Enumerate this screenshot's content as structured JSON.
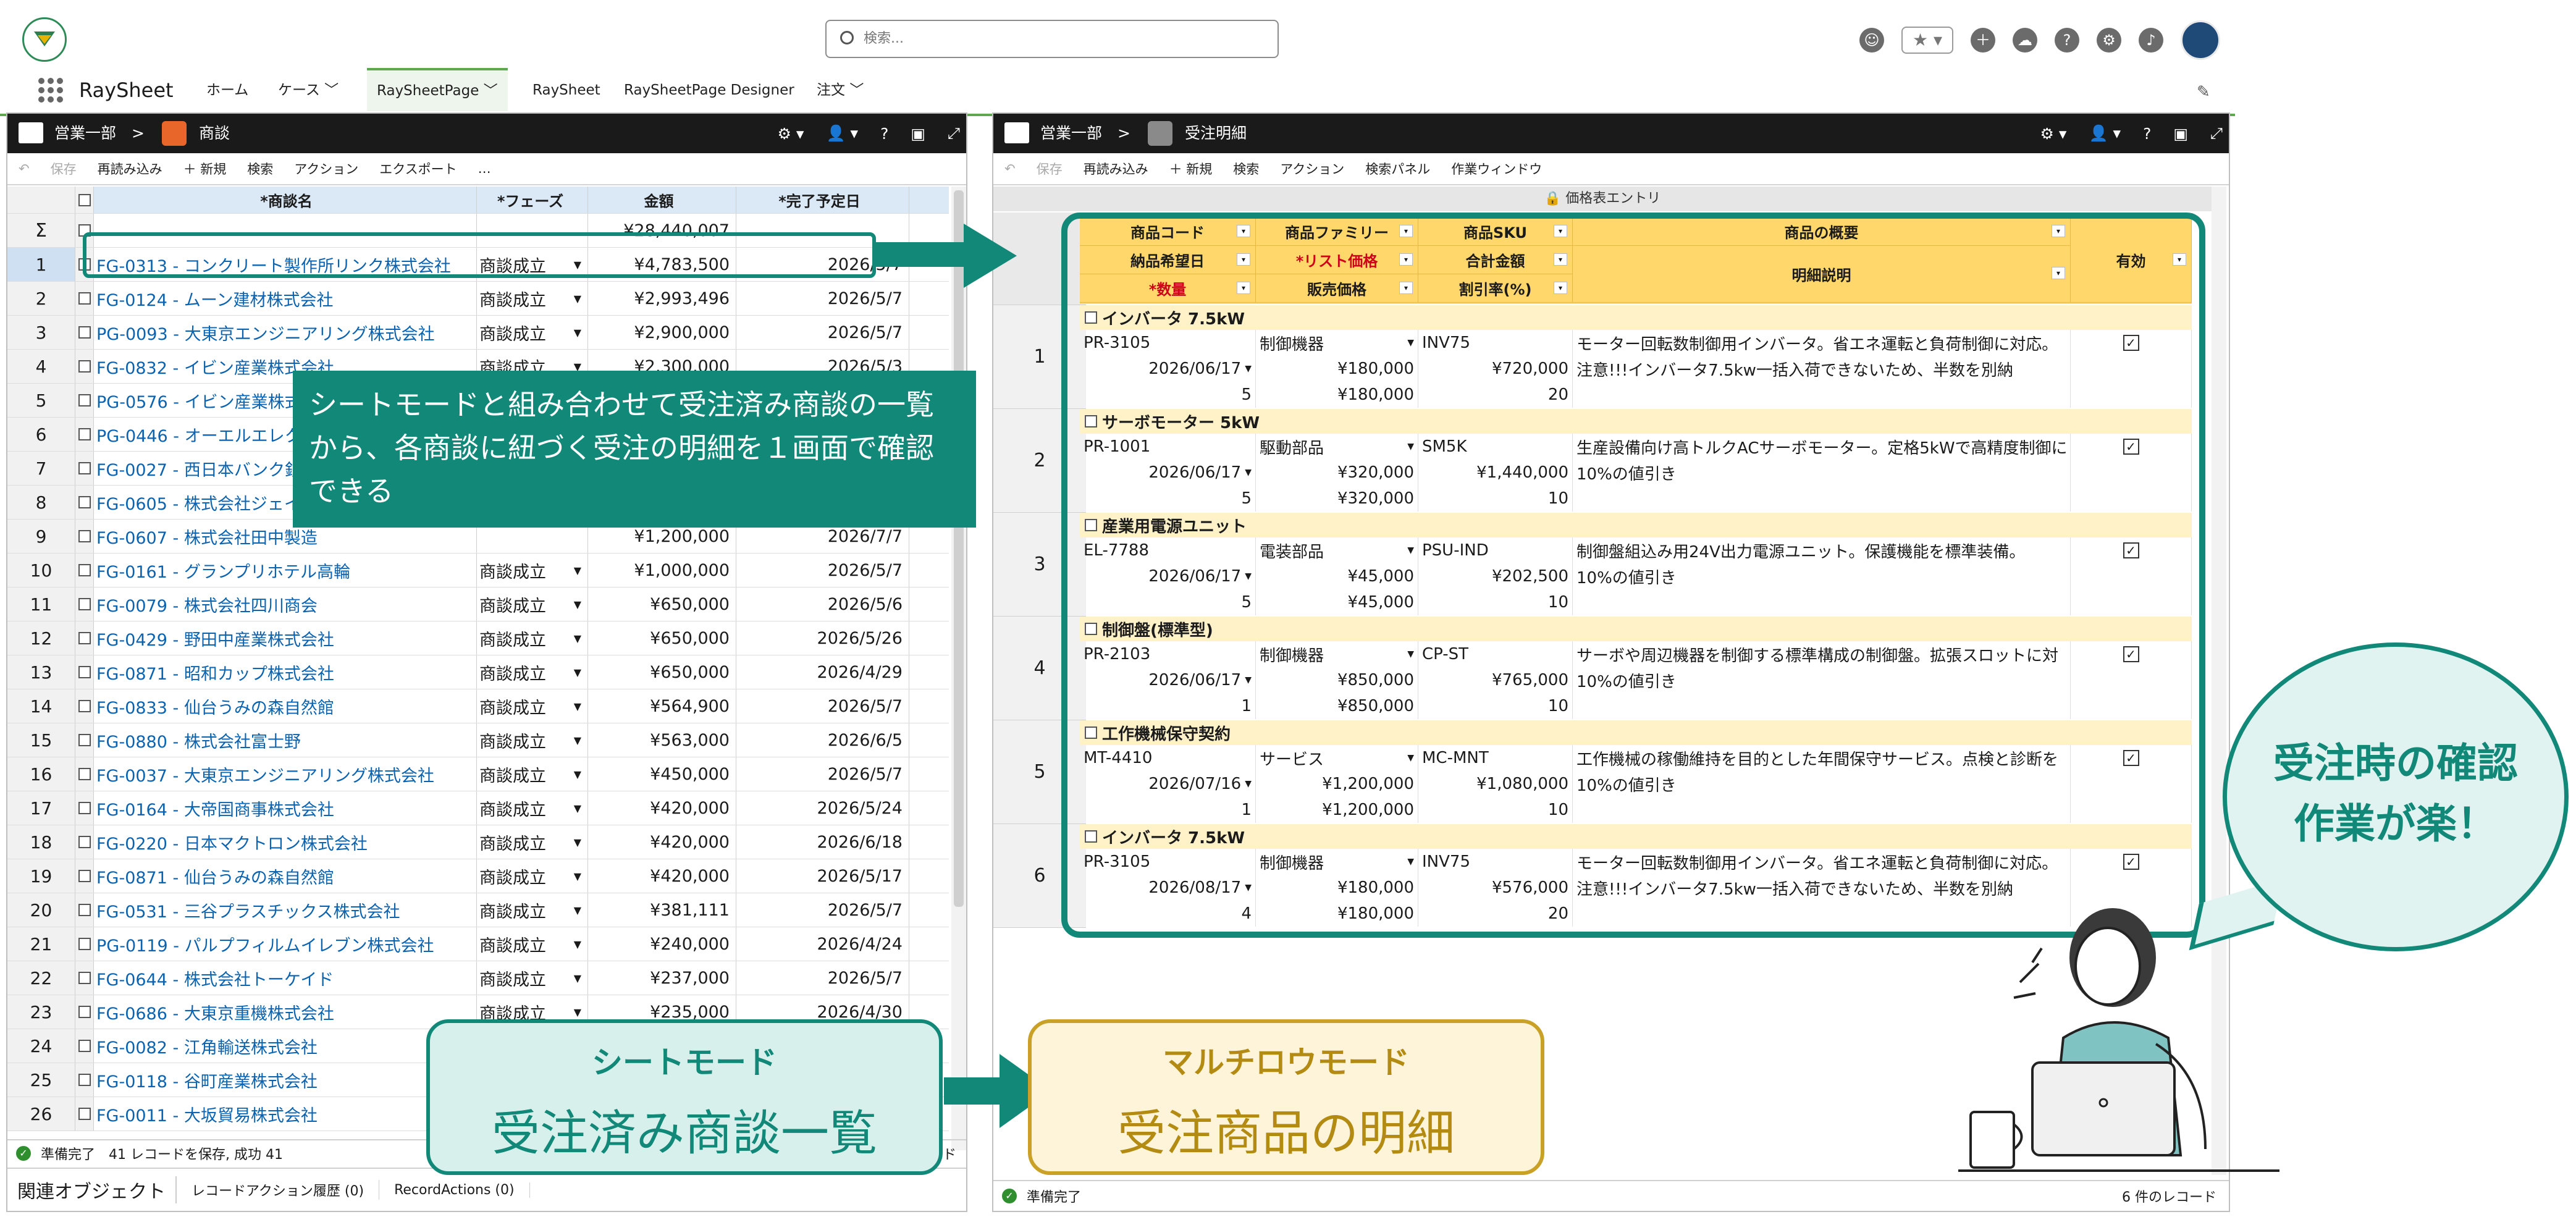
{
  "header": {
    "search_placeholder": "検索...",
    "app_name": "RaySheet",
    "nav": [
      "ホーム",
      "ケース",
      "RaySheetPage",
      "RaySheet",
      "RaySheetPage Designer",
      "注文"
    ]
  },
  "left": {
    "breadcrumb1": "営業一部",
    "breadcrumb2": "商談",
    "toolbar": [
      "保存",
      "再読み込み",
      "＋ 新規",
      "検索",
      "アクション",
      "エクスポート",
      "…"
    ],
    "columns": [
      "*商談名",
      "*フェーズ",
      "金額",
      "*完了予定日"
    ],
    "sum_label": "Σ",
    "sum_amount": "¥28,440,007",
    "rows": [
      {
        "n": "1",
        "name": "FG-0313 - コンクリート製作所リンク株式会社",
        "phase": "商談成立",
        "amount": "¥4,783,500",
        "date": "2026/5/7"
      },
      {
        "n": "2",
        "name": "FG-0124 - ムーン建材株式会社",
        "phase": "商談成立",
        "amount": "¥2,993,496",
        "date": "2026/5/7"
      },
      {
        "n": "3",
        "name": "PG-0093 - 大東京エンジニアリング株式会社",
        "phase": "商談成立",
        "amount": "¥2,900,000",
        "date": "2026/5/7"
      },
      {
        "n": "4",
        "name": "FG-0832 - イビン産業株式会社",
        "phase": "商談成立",
        "amount": "¥2,300,000",
        "date": "2026/5/3"
      },
      {
        "n": "5",
        "name": "PG-0576 - イビン産業株式会社",
        "phase": "",
        "amount": "",
        "date": ""
      },
      {
        "n": "6",
        "name": "PG-0446 - オーエルエレクト",
        "phase": "",
        "amount": "",
        "date": ""
      },
      {
        "n": "7",
        "name": "FG-0027 - 西日本バンク銀",
        "phase": "",
        "amount": "",
        "date": ""
      },
      {
        "n": "8",
        "name": "FG-0605 - 株式会社ジェイ",
        "phase": "",
        "amount": "",
        "date": ""
      },
      {
        "n": "9",
        "name": "FG-0607 - 株式会社田中製造",
        "phase": "",
        "amount": "¥1,200,000",
        "date": "2026/7/7"
      },
      {
        "n": "10",
        "name": "FG-0161 - グランプリホテル高輪",
        "phase": "商談成立",
        "amount": "¥1,000,000",
        "date": "2026/5/7"
      },
      {
        "n": "11",
        "name": "FG-0079 - 株式会社四川商会",
        "phase": "商談成立",
        "amount": "¥650,000",
        "date": "2026/5/6"
      },
      {
        "n": "12",
        "name": "FG-0429 - 野田中産業株式会社",
        "phase": "商談成立",
        "amount": "¥650,000",
        "date": "2026/5/26"
      },
      {
        "n": "13",
        "name": "FG-0871 - 昭和カップ株式会社",
        "phase": "商談成立",
        "amount": "¥650,000",
        "date": "2026/4/29"
      },
      {
        "n": "14",
        "name": "FG-0833 - 仙台うみの森自然館",
        "phase": "商談成立",
        "amount": "¥564,900",
        "date": "2026/5/7"
      },
      {
        "n": "15",
        "name": "FG-0880 - 株式会社富士野",
        "phase": "商談成立",
        "amount": "¥563,000",
        "date": "2026/6/5"
      },
      {
        "n": "16",
        "name": "FG-0037 - 大東京エンジニアリング株式会社",
        "phase": "商談成立",
        "amount": "¥450,000",
        "date": "2026/5/7"
      },
      {
        "n": "17",
        "name": "FG-0164 - 大帝国商事株式会社",
        "phase": "商談成立",
        "amount": "¥420,000",
        "date": "2026/5/24"
      },
      {
        "n": "18",
        "name": "FG-0220 - 日本マクトロン株式会社",
        "phase": "商談成立",
        "amount": "¥420,000",
        "date": "2026/6/18"
      },
      {
        "n": "19",
        "name": "FG-0871 - 仙台うみの森自然館",
        "phase": "商談成立",
        "amount": "¥420,000",
        "date": "2026/5/17"
      },
      {
        "n": "20",
        "name": "FG-0531 - 三谷プラスチックス株式会社",
        "phase": "商談成立",
        "amount": "¥381,111",
        "date": "2026/5/7"
      },
      {
        "n": "21",
        "name": "PG-0119 - パルプフィルムイレブン株式会社",
        "phase": "商談成立",
        "amount": "¥240,000",
        "date": "2026/4/24"
      },
      {
        "n": "22",
        "name": "FG-0644 - 株式会社トーケイド",
        "phase": "商談成立",
        "amount": "¥237,000",
        "date": "2026/5/7"
      },
      {
        "n": "23",
        "name": "FG-0686 - 大東京重機株式会社",
        "phase": "商談成立",
        "amount": "¥235,000",
        "date": "2026/4/30"
      },
      {
        "n": "24",
        "name": "FG-0082 - 江角輸送株式会社",
        "phase": "",
        "amount": "",
        "date": ""
      },
      {
        "n": "25",
        "name": "FG-0118 - 谷町産業株式会社",
        "phase": "",
        "amount": "",
        "date": ""
      },
      {
        "n": "26",
        "name": "FG-0011 - 大坂貿易株式会社",
        "phase": "",
        "amount": "",
        "date": ""
      }
    ],
    "status": "準備完了　41 レコードを保存, 成功 41",
    "status_right": "ード",
    "related": "関連オブジェクト",
    "tab1": "レコードアクション履歴 (0)",
    "tab2": "RecordActions (0)"
  },
  "right": {
    "breadcrumb1": "営業一部",
    "breadcrumb2": "受注明細",
    "toolbar": [
      "保存",
      "再読み込み",
      "＋ 新規",
      "検索",
      "アクション",
      "検索パネル",
      "作業ウィンドウ"
    ],
    "section_title": "価格表エントリ",
    "headers_row1": [
      "商品コード",
      "商品ファミリー",
      "商品SKU",
      "商品の概要",
      "有効"
    ],
    "headers_row2": [
      "納品希望日",
      "*リスト価格",
      "合計金額",
      "明細説明"
    ],
    "headers_row3": [
      "*数量",
      "販売価格",
      "割引率(%)"
    ],
    "records": [
      {
        "n": "1",
        "group": "インバータ 7.5kW",
        "code": "PR-3105",
        "family": "制御機器",
        "sku": "INV75",
        "desc": "モーター回転数制御用インバータ。省エネ運転と負荷制御に対応。",
        "date": "2026/06/17",
        "list": "¥180,000",
        "total": "¥720,000",
        "note": "注意!!!インバータ7.5kw一括入荷できないため、半数を別納",
        "qty": "5",
        "price": "¥180,000",
        "disc": "20"
      },
      {
        "n": "2",
        "group": "サーボモーター 5kW",
        "code": "PR-1001",
        "family": "駆動部品",
        "sku": "SM5K",
        "desc": "生産設備向け高トルクACサーボモーター。定格5kWで高精度制御に",
        "date": "2026/06/17",
        "list": "¥320,000",
        "total": "¥1,440,000",
        "note": "10%の値引き",
        "qty": "5",
        "price": "¥320,000",
        "disc": "10"
      },
      {
        "n": "3",
        "group": "産業用電源ユニット",
        "code": "EL-7788",
        "family": "電装部品",
        "sku": "PSU-IND",
        "desc": "制御盤組込み用24V出力電源ユニット。保護機能を標準装備。",
        "date": "2026/06/17",
        "list": "¥45,000",
        "total": "¥202,500",
        "note": "10%の値引き",
        "qty": "5",
        "price": "¥45,000",
        "disc": "10"
      },
      {
        "n": "4",
        "group": "制御盤(標準型)",
        "code": "PR-2103",
        "family": "制御機器",
        "sku": "CP-ST",
        "desc": "サーボや周辺機器を制御する標準構成の制御盤。拡張スロットに対",
        "date": "2026/06/17",
        "list": "¥850,000",
        "total": "¥765,000",
        "note": "10%の値引き",
        "qty": "1",
        "price": "¥850,000",
        "disc": "10"
      },
      {
        "n": "5",
        "group": "工作機械保守契約",
        "code": "MT-4410",
        "family": "サービス",
        "sku": "MC-MNT",
        "desc": "工作機械の稼働維持を目的とした年間保守サービス。点検と診断を",
        "date": "2026/07/16",
        "list": "¥1,200,000",
        "total": "¥1,080,000",
        "note": "10%の値引き",
        "qty": "1",
        "price": "¥1,200,000",
        "disc": "10"
      },
      {
        "n": "6",
        "group": "インバータ 7.5kW",
        "code": "PR-3105",
        "family": "制御機器",
        "sku": "INV75",
        "desc": "モーター回転数制御用インバータ。省エネ運転と負荷制御に対応。",
        "date": "2026/08/17",
        "list": "¥180,000",
        "total": "¥576,000",
        "note": "注意!!!インバータ7.5kw一括入荷できないため、半数を別納",
        "qty": "4",
        "price": "¥180,000",
        "disc": "20"
      }
    ],
    "status": "準備完了",
    "count": "6 件のレコード"
  },
  "overlay": {
    "callout": "シートモードと組み合わせて受注済み商談の一覧から、各商談に紐づく受注の明細を１画面で確認できる",
    "sheet_mode_title": "シートモード",
    "sheet_mode_sub": "受注済み商談一覧",
    "multi_mode_title": "マルチロウモード",
    "multi_mode_sub": "受注商品の明細",
    "bubble_line1": "受注時の確認",
    "bubble_line2": "作業が楽！"
  },
  "colors": {
    "teal": "#128879",
    "gold": "#c9a126",
    "header_yellow": "#ffd76a",
    "link_blue": "#0b63b0"
  }
}
